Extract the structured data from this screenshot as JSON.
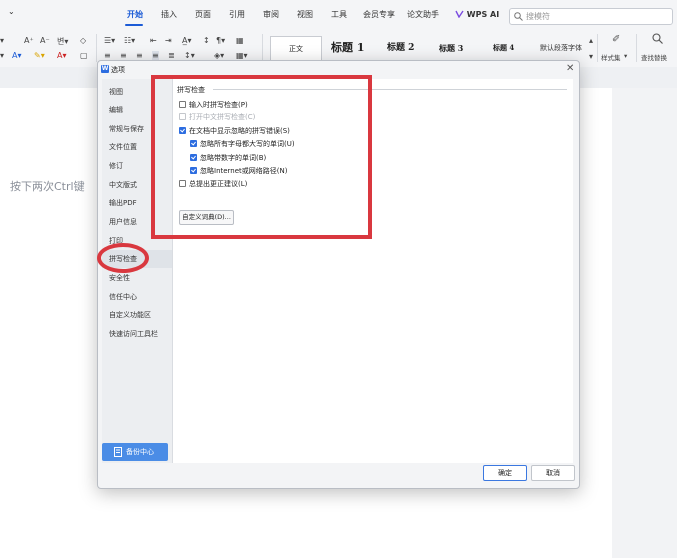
{
  "ribbon": {
    "tabs": [
      "开始",
      "插入",
      "页面",
      "引用",
      "审阅",
      "视图",
      "工具",
      "会员专享",
      "论文助手",
      "WPS AI"
    ],
    "active_tab": "开始",
    "search_placeholder": "搜模符"
  },
  "toolbar": {
    "style_normal": "正文",
    "style_h1": "标题 1",
    "style_h2": "标题 2",
    "style_h3": "标题 3",
    "style_h4": "标题 4",
    "style_default": "默认段落字体",
    "styles_set": "样式集",
    "find_replace": "查找替换"
  },
  "document": {
    "hint_text": "按下两次Ctrl键"
  },
  "dialog": {
    "title": "选项",
    "nav_items": [
      "视图",
      "编辑",
      "常规与保存",
      "文件位置",
      "修订",
      "中文版式",
      "输出PDF",
      "用户信息",
      "打印",
      "拼写检查",
      "安全性",
      "信任中心",
      "自定义功能区",
      "快速访问工具栏"
    ],
    "selected_nav": "拼写检查",
    "backup_center": "备份中心",
    "section_title": "拼写检查",
    "options": [
      {
        "label": "输入时拼写检查(P)",
        "checked": false,
        "enabled": true
      },
      {
        "label": "打开中文拼写检查(C)",
        "checked": false,
        "enabled": false
      },
      {
        "label": "在文档中显示忽略的拼写错误(S)",
        "checked": true,
        "enabled": true
      },
      {
        "label": "忽略所有字母都大写的单词(U)",
        "checked": true,
        "enabled": true
      },
      {
        "label": "忽略带数字的单词(B)",
        "checked": true,
        "enabled": true
      },
      {
        "label": "忽略Internet或网络路径(N)",
        "checked": true,
        "enabled": true
      },
      {
        "label": "总提出更正建议(L)",
        "checked": false,
        "enabled": true
      }
    ],
    "custom_dict_button": "自定义词典(D)...",
    "ok_button": "确定",
    "cancel_button": "取消"
  },
  "colors": {
    "accent": "#2d6de0",
    "annotation": "#d9383f"
  }
}
